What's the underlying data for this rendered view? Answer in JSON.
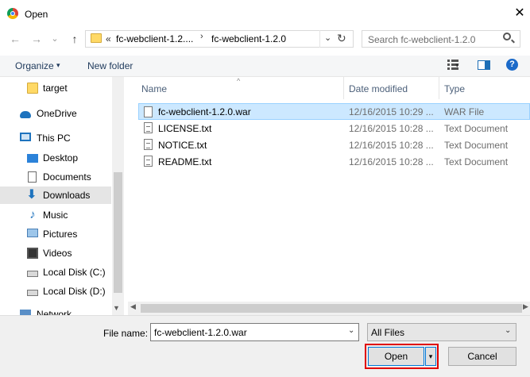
{
  "window": {
    "title": "Open",
    "close_glyph": "✕"
  },
  "nav": {
    "back_glyph": "←",
    "forward_glyph": "→",
    "recent_glyph": "⌄",
    "up_glyph": "↑",
    "address": {
      "prefix": "«",
      "crumb1": "fc-webclient-1.2....",
      "crumb2": "fc-webclient-1.2.0",
      "sep_glyph": "›",
      "dropdown_glyph": "⌄"
    },
    "refresh_glyph": "↻",
    "search": {
      "placeholder": "Search fc-webclient-1.2.0"
    }
  },
  "command_bar": {
    "organize_label": "Organize",
    "organize_arrow": "▾",
    "new_folder_label": "New folder",
    "view_arrow": "▾",
    "help_glyph": "?"
  },
  "sidebar": {
    "items": [
      {
        "label": "target",
        "icon": "folder-icon"
      },
      {
        "label": "OneDrive",
        "icon": "cloud-icon"
      },
      {
        "label": "This PC",
        "icon": "computer-icon"
      },
      {
        "label": "Desktop",
        "icon": "desktop-icon"
      },
      {
        "label": "Documents",
        "icon": "documents-icon"
      },
      {
        "label": "Downloads",
        "icon": "download-icon"
      },
      {
        "label": "Music",
        "icon": "music-icon"
      },
      {
        "label": "Pictures",
        "icon": "pictures-icon"
      },
      {
        "label": "Videos",
        "icon": "videos-icon"
      },
      {
        "label": "Local Disk (C:)",
        "icon": "drive-icon"
      },
      {
        "label": "Local Disk (D:)",
        "icon": "drive-icon"
      },
      {
        "label": "Network",
        "icon": "network-icon"
      }
    ],
    "selected": "Downloads",
    "scroll_down_glyph": "▼"
  },
  "file_list": {
    "columns": {
      "name": "Name",
      "date": "Date modified",
      "type": "Type"
    },
    "sort_glyph": "^",
    "rows": [
      {
        "name": "fc-webclient-1.2.0.war",
        "date": "12/16/2015 10:29 ...",
        "type": "WAR File"
      },
      {
        "name": "LICENSE.txt",
        "date": "12/16/2015 10:28 ...",
        "type": "Text Document"
      },
      {
        "name": "NOTICE.txt",
        "date": "12/16/2015 10:28 ...",
        "type": "Text Document"
      },
      {
        "name": "README.txt",
        "date": "12/16/2015 10:28 ...",
        "type": "Text Document"
      }
    ],
    "selected_row": "fc-webclient-1.2.0.war",
    "scroll_left_glyph": "◀",
    "scroll_right_glyph": "▶"
  },
  "footer": {
    "file_name_label": "File name:",
    "file_name_value": "fc-webclient-1.2.0.war",
    "file_name_arrow": "⌄",
    "file_type_value": "All Files",
    "file_type_arrow": "⌄",
    "open_label": "Open",
    "open_arrow": "▾",
    "cancel_label": "Cancel"
  },
  "colors": {
    "selection": "#cce8ff",
    "highlight_outline": "#e00000",
    "accent": "#0078d7"
  }
}
